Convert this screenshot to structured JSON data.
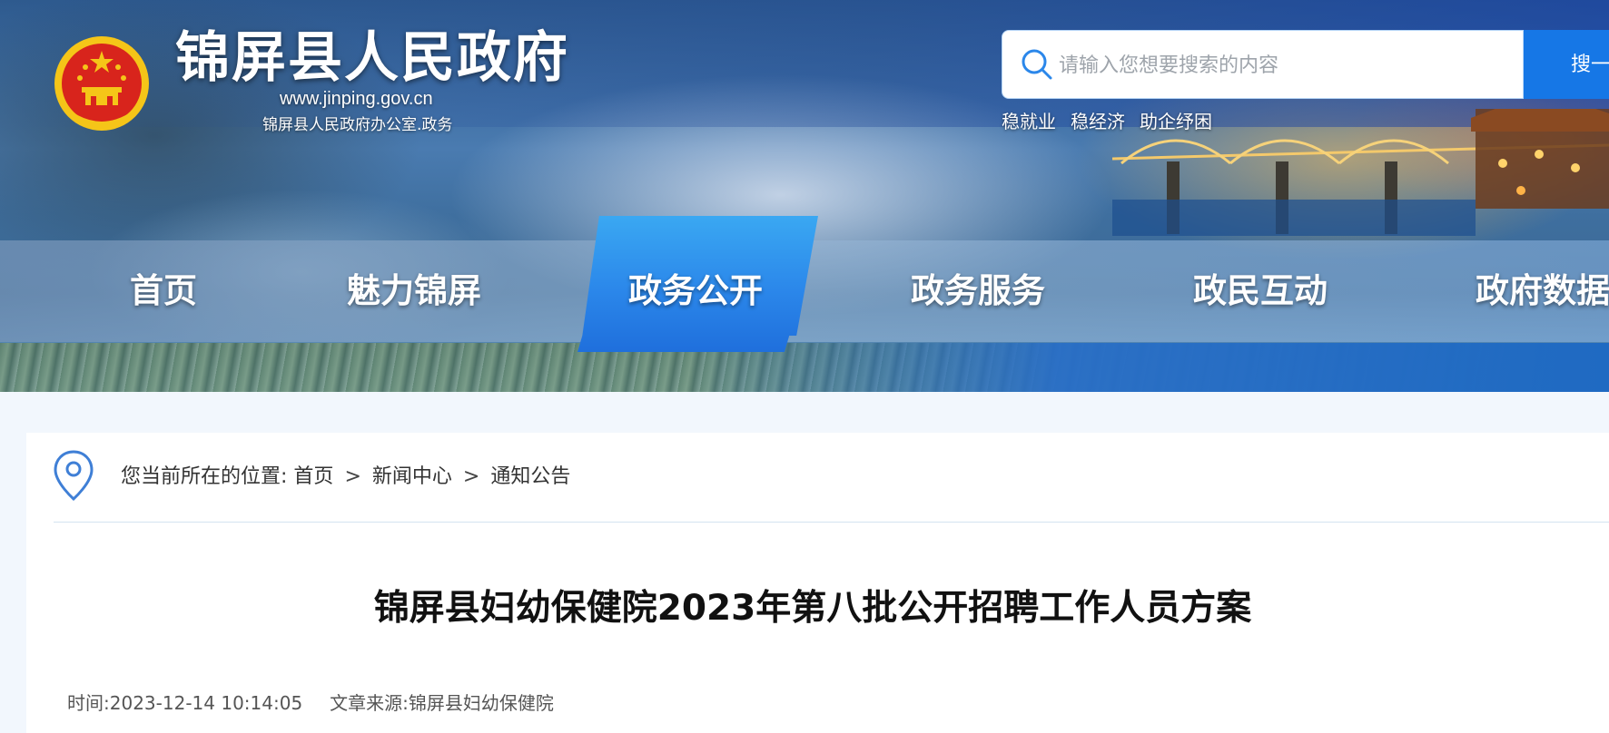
{
  "header": {
    "site_title": "锦屏县人民政府",
    "domain": "www.jinping.gov.cn",
    "org_label": "锦屏县人民政府办公室.政务"
  },
  "search": {
    "placeholder": "请输入您想要搜索的内容",
    "button_label": "搜一",
    "quick_links": [
      "稳就业",
      "稳经济",
      "助企纾困"
    ]
  },
  "nav": {
    "items": [
      "首页",
      "魅力锦屏",
      "政务公开",
      "政务服务",
      "政民互动",
      "政府数据"
    ],
    "active": "政务公开"
  },
  "breadcrumb": {
    "prefix": "您当前所在的位置:",
    "items": [
      "首页",
      "新闻中心",
      "通知公告"
    ],
    "separator": ">"
  },
  "article": {
    "title": "锦屏县妇幼保健院2023年第八批公开招聘工作人员方案",
    "time_label": "时间:",
    "time": "2023-12-14 10:14:05",
    "source_label": "文章来源:",
    "source": "锦屏县妇幼保健院"
  },
  "colors": {
    "accent": "#1677e6",
    "nav_active": "#2b87ea",
    "page_bg": "#f2f7fd",
    "emblem_red": "#d8241c",
    "emblem_gold": "#f5c518"
  }
}
